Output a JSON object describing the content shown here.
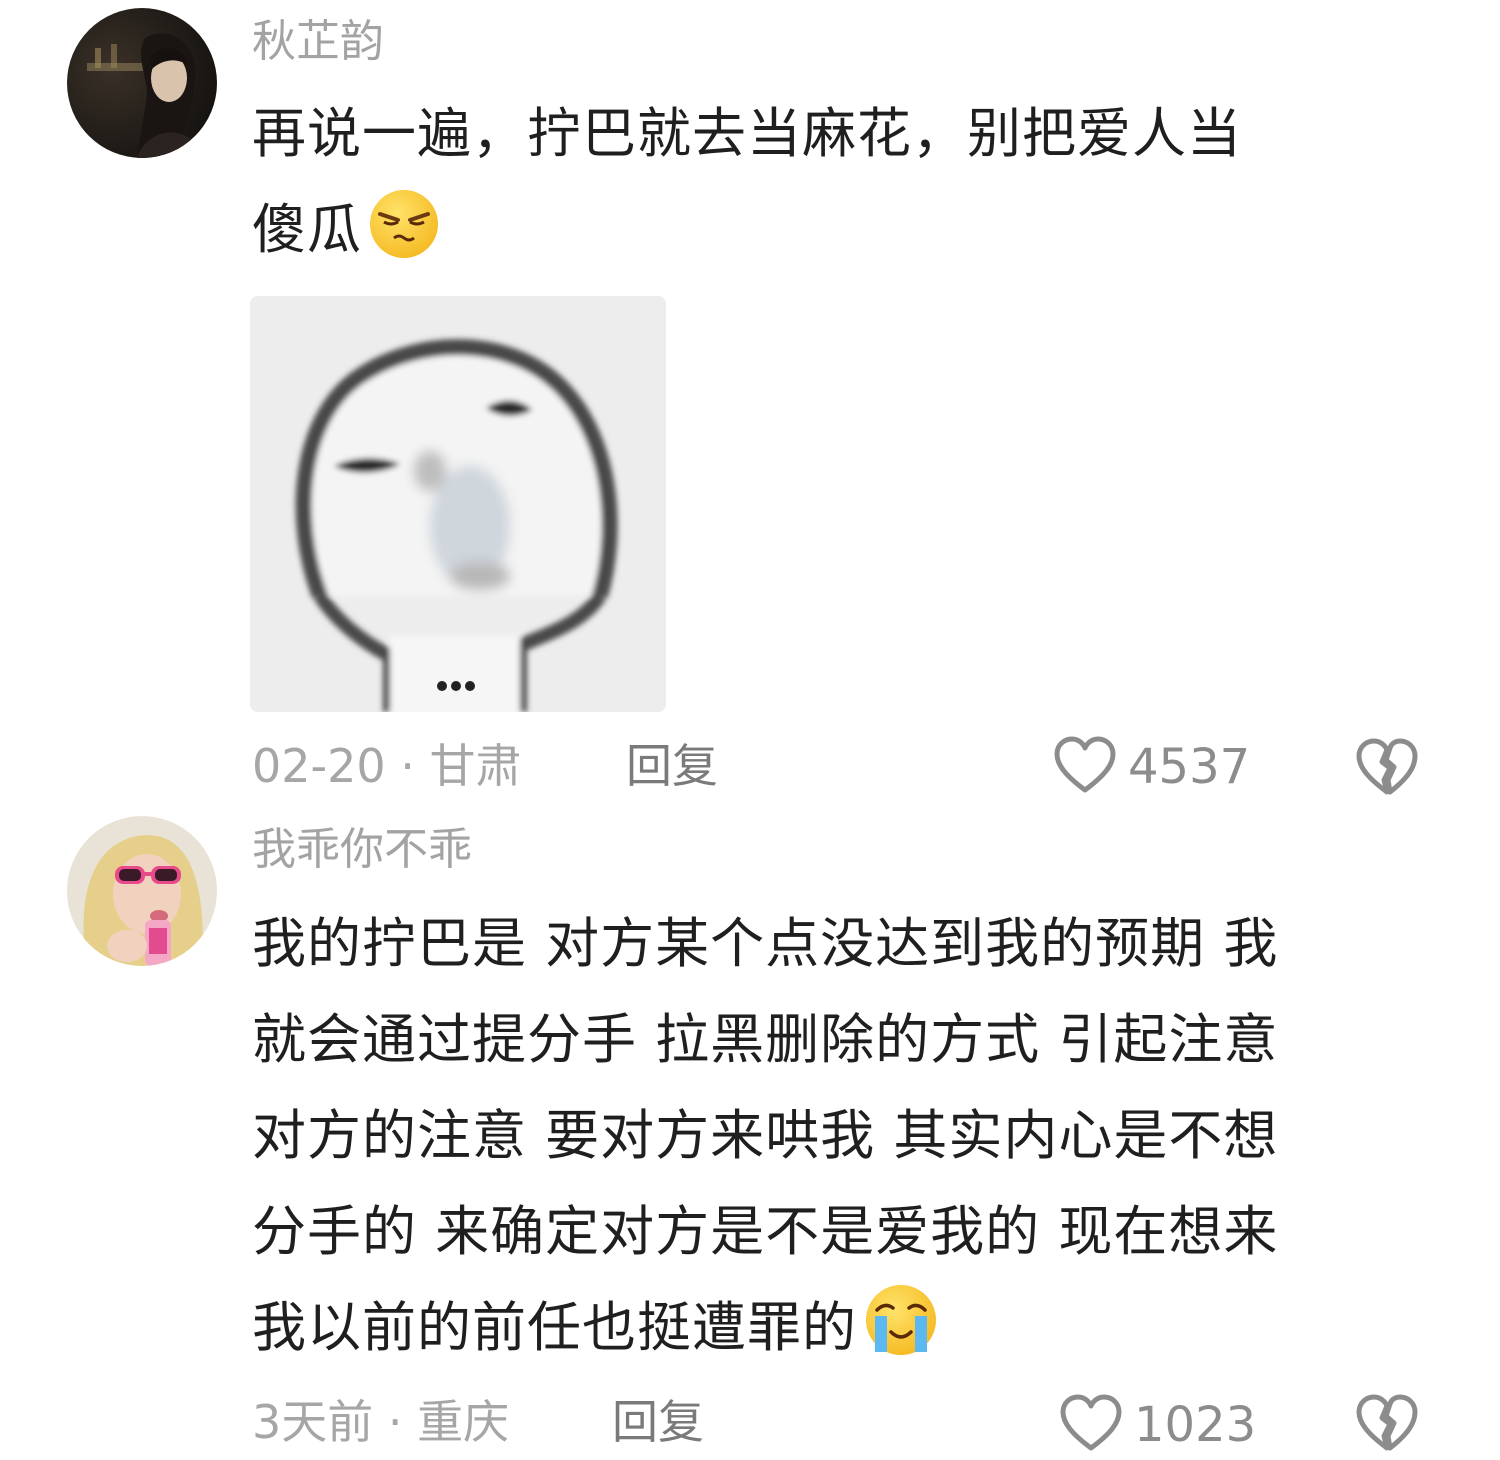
{
  "comments": [
    {
      "username": "秋芷韵",
      "text_lines": [
        "再说一遍，拧巴就去当麻花，别把爱人当",
        "傻瓜"
      ],
      "inline_emoji": "annoyed-face-emoji",
      "sticker": {
        "icon": "meme-face-sticker",
        "caption": "..."
      },
      "date": "02-20",
      "separator": " · ",
      "location": "甘肃",
      "reply_label": "回复",
      "like_count": "4537"
    },
    {
      "username": "我乖你不乖",
      "text_lines": [
        "我的拧巴是 对方某个点没达到我的预期 我",
        "就会通过提分手 拉黑删除的方式 引起注意",
        "对方的注意 要对方来哄我 其实内心是不想",
        "分手的 来确定对方是不是爱我的  现在想来",
        "我以前的前任也挺遭罪的"
      ],
      "inline_emoji": "crying-face-emoji",
      "date": "3天前",
      "separator": " · ",
      "location": "重庆",
      "reply_label": "回复",
      "like_count": "1023"
    }
  ],
  "colors": {
    "text": "#1f1f1f",
    "meta": "#a6a6a6",
    "icon": "#8c8c8c"
  }
}
